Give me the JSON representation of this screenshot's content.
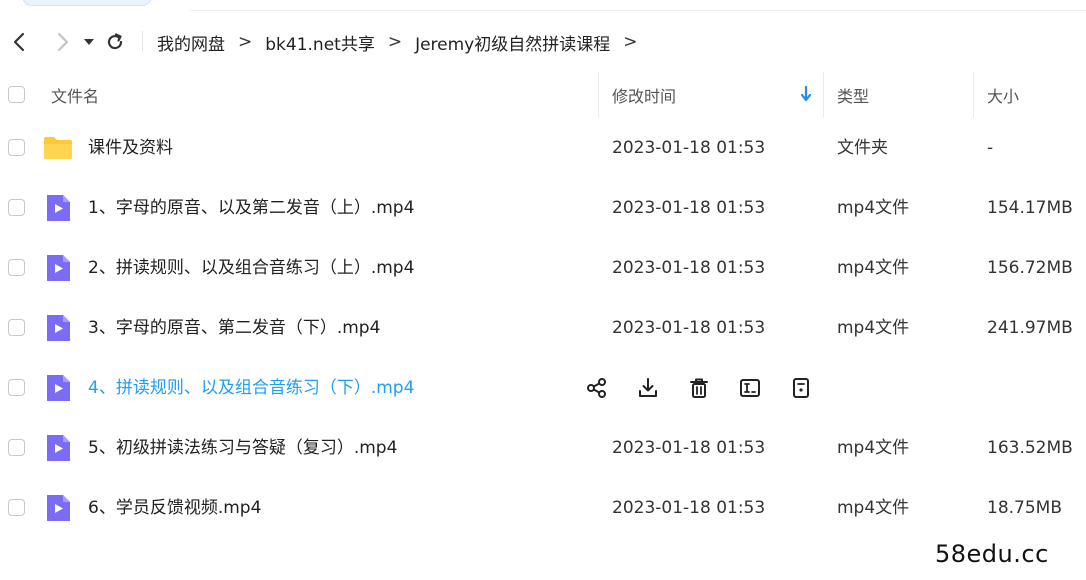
{
  "nav": {
    "breadcrumbs": [
      "我的网盘",
      "bk41.net共享",
      "Jeremy初级自然拼读课程"
    ],
    "separator": ">"
  },
  "columns": {
    "name": "文件名",
    "modified": "修改时间",
    "type": "类型",
    "size": "大小"
  },
  "rows": [
    {
      "name": "课件及资料",
      "modified": "2023-01-18 01:53",
      "type": "文件夹",
      "size": "-",
      "icon": "folder-icon"
    },
    {
      "name": "1、字母的原音、以及第二发音（上）.mp4",
      "modified": "2023-01-18 01:53",
      "type": "mp4文件",
      "size": "154.17MB",
      "icon": "video-file-icon"
    },
    {
      "name": "2、拼读规则、以及组合音练习（上）.mp4",
      "modified": "2023-01-18 01:53",
      "type": "mp4文件",
      "size": "156.72MB",
      "icon": "video-file-icon"
    },
    {
      "name": "3、字母的原音、第二发音（下）.mp4",
      "modified": "2023-01-18 01:53",
      "type": "mp4文件",
      "size": "241.97MB",
      "icon": "video-file-icon"
    },
    {
      "name": "4、拼读规则、以及组合音练习（下）.mp4",
      "modified": "",
      "type": "",
      "size": "",
      "icon": "video-file-icon"
    },
    {
      "name": "5、初级拼读法练习与答疑（复习）.mp4",
      "modified": "2023-01-18 01:53",
      "type": "mp4文件",
      "size": "163.52MB",
      "icon": "video-file-icon"
    },
    {
      "name": "6、学员反馈视频.mp4",
      "modified": "2023-01-18 01:53",
      "type": "mp4文件",
      "size": "18.75MB",
      "icon": "video-file-icon"
    }
  ],
  "watermark": "58edu.cc",
  "colors": {
    "accent": "#1f8cf0",
    "hover_text": "#1f9ef4",
    "folder": "#ffc933",
    "video": "#7b6cf6"
  }
}
